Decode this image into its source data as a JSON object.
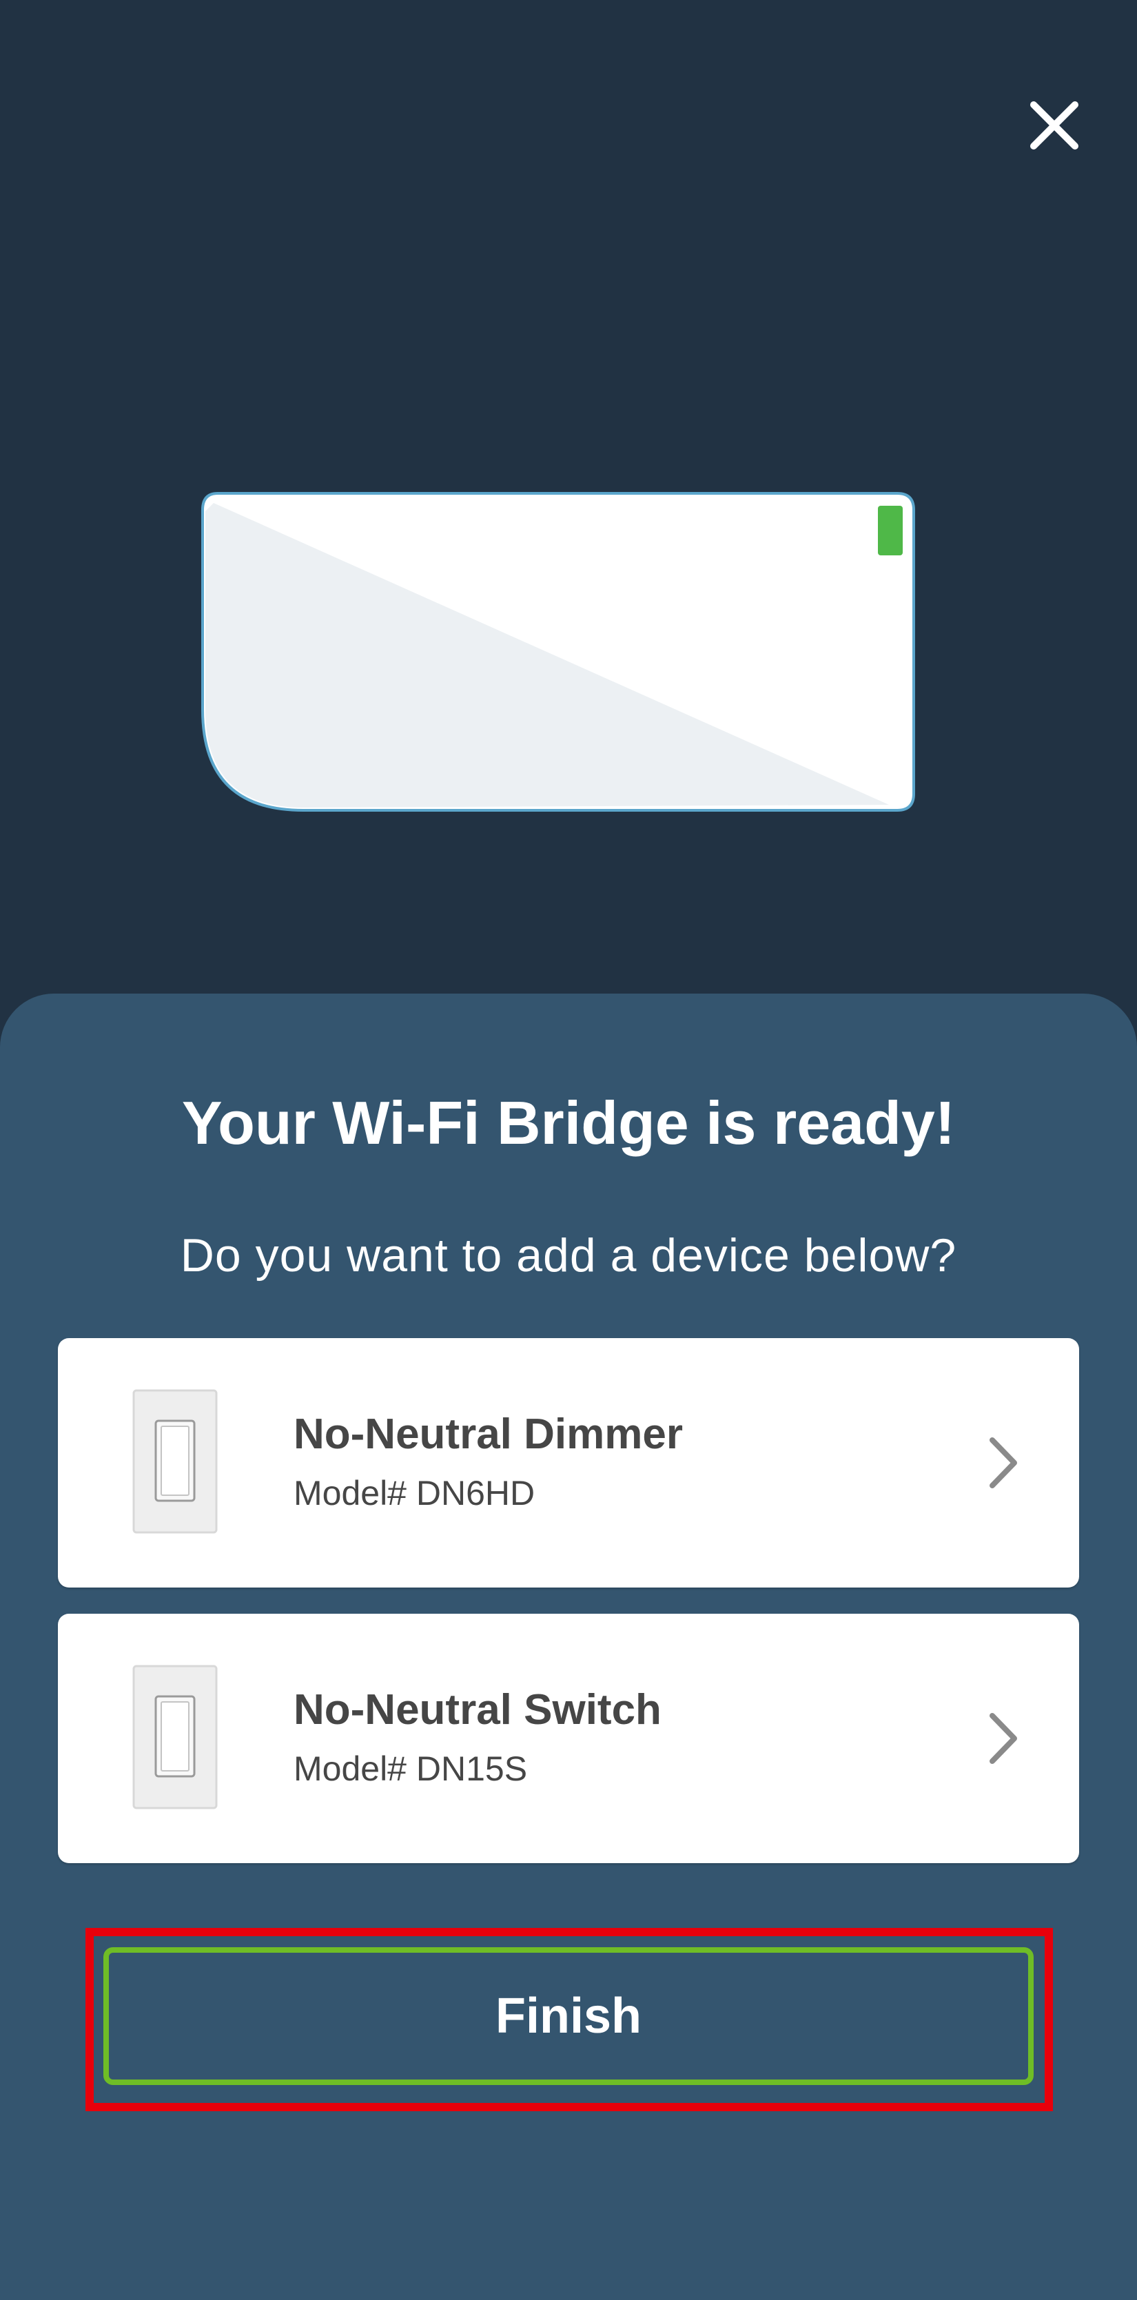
{
  "header": {
    "close_icon": "close-icon"
  },
  "illustration": {
    "name": "wifi-bridge-illustration",
    "led_color": "#4fb848"
  },
  "main": {
    "title": "Your Wi-Fi Bridge is ready!",
    "subtitle": "Do you want to add a device below?"
  },
  "devices": [
    {
      "name": "No-Neutral Dimmer",
      "model": "Model# DN6HD",
      "icon": "dimmer-device-icon"
    },
    {
      "name": "No-Neutral Switch",
      "model": "Model# DN15S",
      "icon": "switch-device-icon"
    }
  ],
  "footer": {
    "finish_label": "Finish"
  },
  "colors": {
    "background_top": "#213243",
    "sheet": "#34556f",
    "accent_green": "#6fbd26",
    "highlight_red": "#e8000b"
  }
}
